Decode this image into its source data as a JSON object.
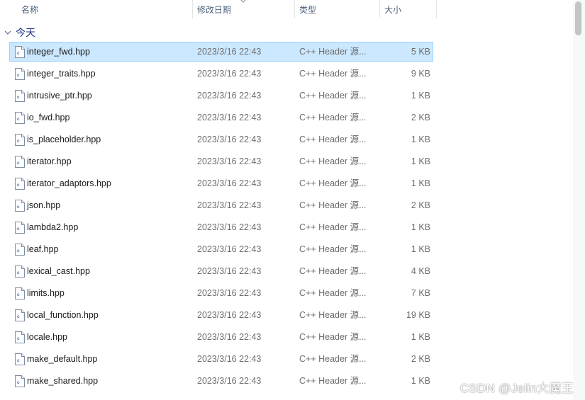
{
  "columns": {
    "name": "名称",
    "date": "修改日期",
    "type": "类型",
    "size": "大小",
    "sort_icon": "chevron-down-icon"
  },
  "group": {
    "label": "今天",
    "icon": "chevron-down-icon"
  },
  "files": [
    {
      "name": "integer_fwd.hpp",
      "date": "2023/3/16 22:43",
      "type": "C++ Header 源...",
      "size": "5 KB",
      "selected": true
    },
    {
      "name": "integer_traits.hpp",
      "date": "2023/3/16 22:43",
      "type": "C++ Header 源...",
      "size": "9 KB"
    },
    {
      "name": "intrusive_ptr.hpp",
      "date": "2023/3/16 22:43",
      "type": "C++ Header 源...",
      "size": "1 KB"
    },
    {
      "name": "io_fwd.hpp",
      "date": "2023/3/16 22:43",
      "type": "C++ Header 源...",
      "size": "2 KB"
    },
    {
      "name": "is_placeholder.hpp",
      "date": "2023/3/16 22:43",
      "type": "C++ Header 源...",
      "size": "1 KB"
    },
    {
      "name": "iterator.hpp",
      "date": "2023/3/16 22:43",
      "type": "C++ Header 源...",
      "size": "1 KB"
    },
    {
      "name": "iterator_adaptors.hpp",
      "date": "2023/3/16 22:43",
      "type": "C++ Header 源...",
      "size": "1 KB"
    },
    {
      "name": "json.hpp",
      "date": "2023/3/16 22:43",
      "type": "C++ Header 源...",
      "size": "2 KB"
    },
    {
      "name": "lambda2.hpp",
      "date": "2023/3/16 22:43",
      "type": "C++ Header 源...",
      "size": "1 KB"
    },
    {
      "name": "leaf.hpp",
      "date": "2023/3/16 22:43",
      "type": "C++ Header 源...",
      "size": "1 KB"
    },
    {
      "name": "lexical_cast.hpp",
      "date": "2023/3/16 22:43",
      "type": "C++ Header 源...",
      "size": "4 KB"
    },
    {
      "name": "limits.hpp",
      "date": "2023/3/16 22:43",
      "type": "C++ Header 源...",
      "size": "7 KB"
    },
    {
      "name": "local_function.hpp",
      "date": "2023/3/16 22:43",
      "type": "C++ Header 源...",
      "size": "19 KB"
    },
    {
      "name": "locale.hpp",
      "date": "2023/3/16 22:43",
      "type": "C++ Header 源...",
      "size": "1 KB"
    },
    {
      "name": "make_default.hpp",
      "date": "2023/3/16 22:43",
      "type": "C++ Header 源...",
      "size": "2 KB"
    },
    {
      "name": "make_shared.hpp",
      "date": "2023/3/16 22:43",
      "type": "C++ Header 源...",
      "size": "1 KB"
    }
  ],
  "file_icon": "cpp-header-file-icon",
  "watermark": "CSDN @Jelin大魔王",
  "colors": {
    "selection_bg": "#cce8ff",
    "selection_border": "#99d1ff",
    "group_text": "#1e3287",
    "header_text": "#4c607a"
  }
}
